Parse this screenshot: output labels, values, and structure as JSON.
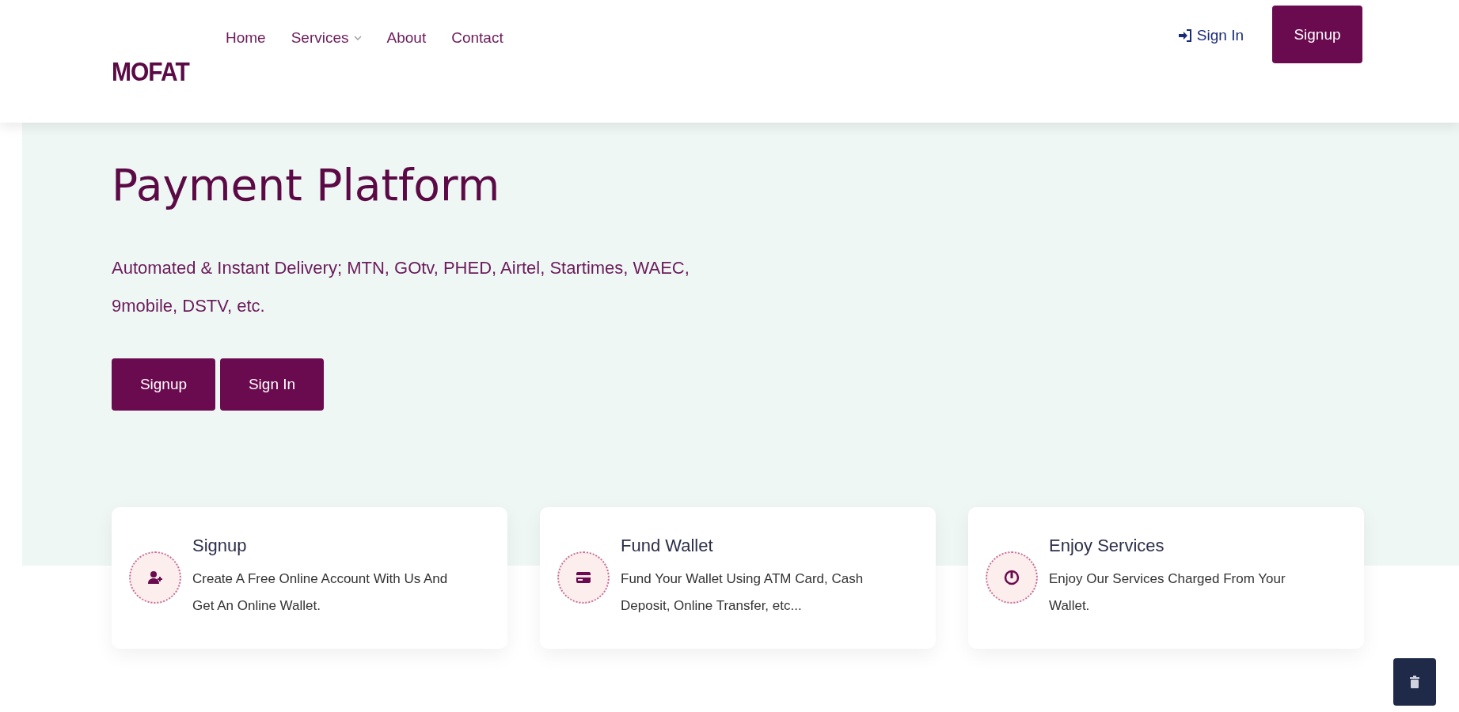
{
  "header": {
    "logo": "MOFAT",
    "nav": [
      {
        "label": "Home",
        "dropdown": false
      },
      {
        "label": "Services",
        "dropdown": true
      },
      {
        "label": "About",
        "dropdown": false
      },
      {
        "label": "Contact",
        "dropdown": false
      }
    ],
    "sign_in": "Sign In",
    "signup": "Signup"
  },
  "hero": {
    "title_lines": [
      "Payment Platform"
    ],
    "subtitle": "Automated & Instant Delivery; MTN, GOtv, PHED, Airtel, Startimes, WAEC, 9mobile, DSTV, etc.",
    "buttons": [
      "Signup",
      "Sign In"
    ]
  },
  "steps": [
    {
      "kind": "user",
      "title": "Signup",
      "text": "Create A Free Online Account With Us And Get An Online Wallet."
    },
    {
      "kind": "card",
      "title": "Fund Wallet",
      "text": "Fund Your Wallet Using ATM Card, Cash Deposit, Online Transfer, etc..."
    },
    {
      "kind": "power",
      "title": "Enjoy Services",
      "text": "Enjoy Our Services Charged From Your Wallet."
    }
  ]
}
